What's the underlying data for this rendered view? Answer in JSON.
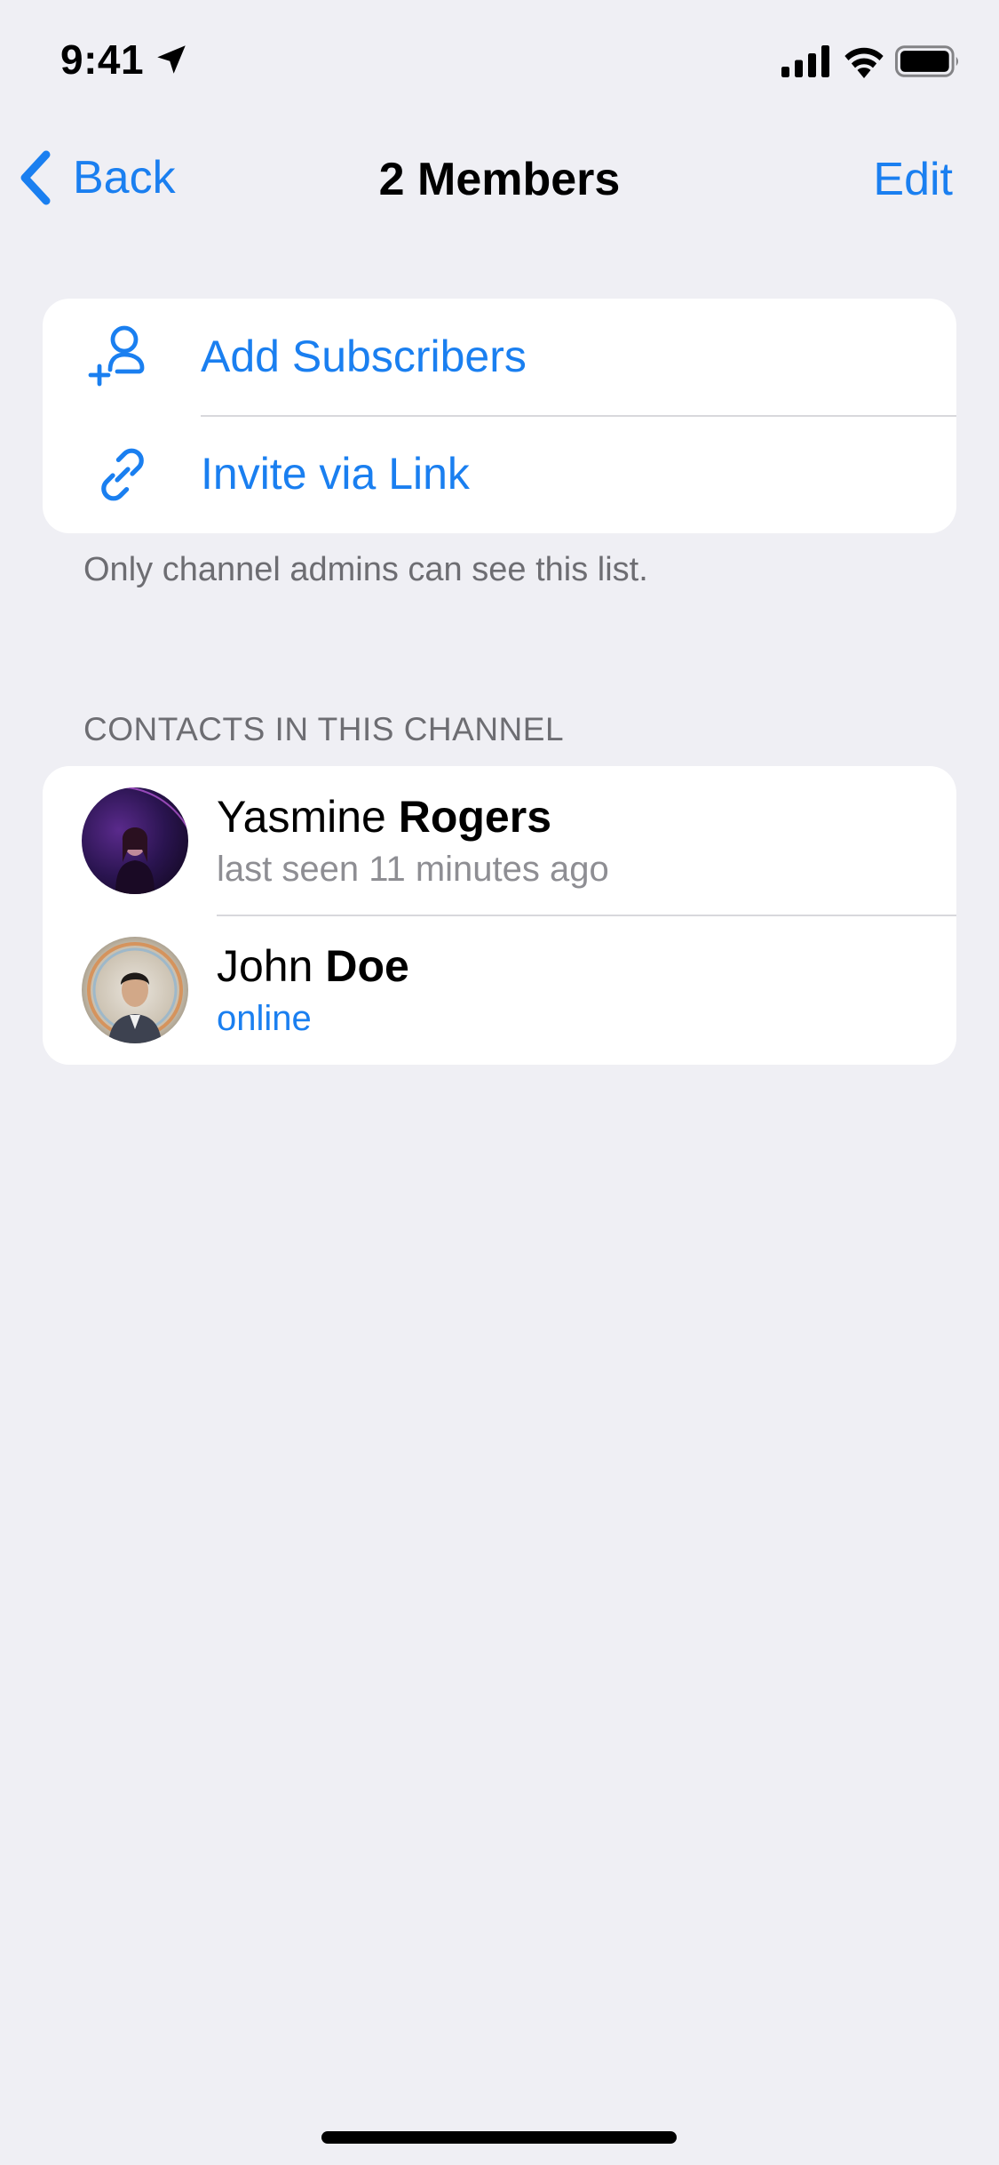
{
  "status_bar": {
    "time": "9:41",
    "icons": [
      "location-arrow-icon",
      "cellular-signal-icon",
      "wifi-icon",
      "battery-icon"
    ]
  },
  "nav": {
    "back_label": "Back",
    "title": "2 Members",
    "edit_label": "Edit"
  },
  "actions": [
    {
      "label": "Add Subscribers",
      "icon": "add-person-icon"
    },
    {
      "label": "Invite via Link",
      "icon": "link-icon"
    }
  ],
  "footer_note": "Only channel admins can see this list.",
  "section_header": "CONTACTS IN THIS CHANNEL",
  "contacts": [
    {
      "first_name": "Yasmine",
      "last_name": "Rogers",
      "status": "last seen 11 minutes ago",
      "online": false
    },
    {
      "first_name": "John",
      "last_name": "Doe",
      "status": "online",
      "online": true
    }
  ],
  "colors": {
    "accent": "#1a7ff0",
    "background": "#efeff4",
    "secondary_text": "#6d6d72",
    "status_gray": "#8e8e93"
  }
}
